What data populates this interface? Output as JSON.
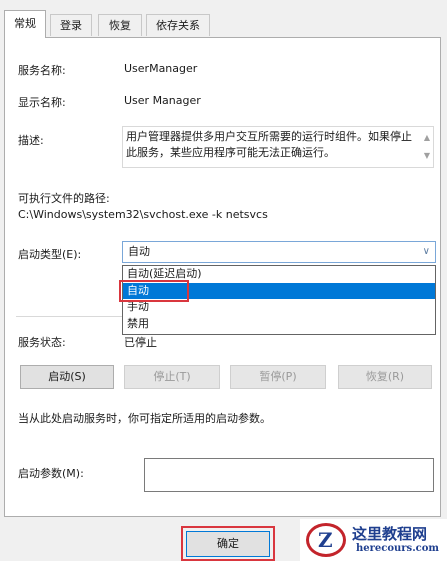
{
  "tabs": [
    {
      "label": "常规"
    },
    {
      "label": "登录"
    },
    {
      "label": "恢复"
    },
    {
      "label": "依存关系"
    }
  ],
  "service": {
    "name_label": "服务名称:",
    "name_value": "UserManager",
    "display_label": "显示名称:",
    "display_value": "User Manager",
    "desc_label": "描述:",
    "desc_value": "用户管理器提供多用户交互所需要的运行时组件。如果停止此服务，某些应用程序可能无法正确运行。",
    "path_label": "可执行文件的路径:",
    "path_value": "C:\\Windows\\system32\\svchost.exe -k netsvcs",
    "startup_label": "启动类型(E):",
    "startup_value": "自动",
    "startup_options": [
      "自动(延迟启动)",
      "自动",
      "手动",
      "禁用"
    ],
    "status_label": "服务状态:",
    "status_value": "已停止"
  },
  "buttons": {
    "start": "启动(S)",
    "stop": "停止(T)",
    "pause": "暂停(P)",
    "resume": "恢复(R)"
  },
  "hint": "当从此处启动服务时，你可指定所适用的启动参数。",
  "param_label": "启动参数(M):",
  "param_value": "",
  "ok_label": "确定",
  "watermark": {
    "text1": "这里教程网",
    "text2": "herecours.com",
    "glyph": "Z"
  },
  "colors": {
    "selection": "#0078d7",
    "highlight_box": "#d9363e"
  }
}
